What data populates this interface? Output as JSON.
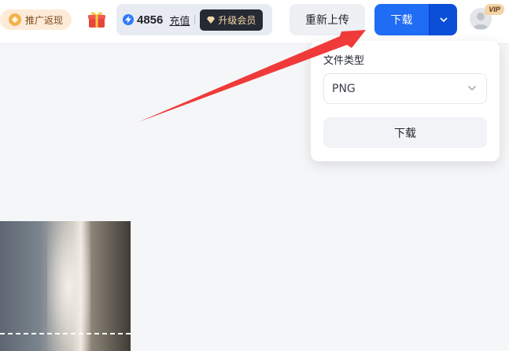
{
  "topbar": {
    "promo_label": "推广返现",
    "points_value": "4856",
    "recharge_label": "充值",
    "upgrade_label": "升级会员",
    "reupload_label": "重新上传",
    "download_label": "下载",
    "vip_badge": "VIP"
  },
  "dropdown": {
    "file_type_label": "文件类型",
    "selected_format": "PNG",
    "download_label": "下载"
  },
  "colors": {
    "accent": "#1f6cf5",
    "annotation_arrow": "#f03a3a"
  },
  "icons": [
    "coin-icon",
    "gift-icon",
    "bolt-icon",
    "diamond-icon",
    "chevron-down-icon",
    "avatar-icon"
  ]
}
